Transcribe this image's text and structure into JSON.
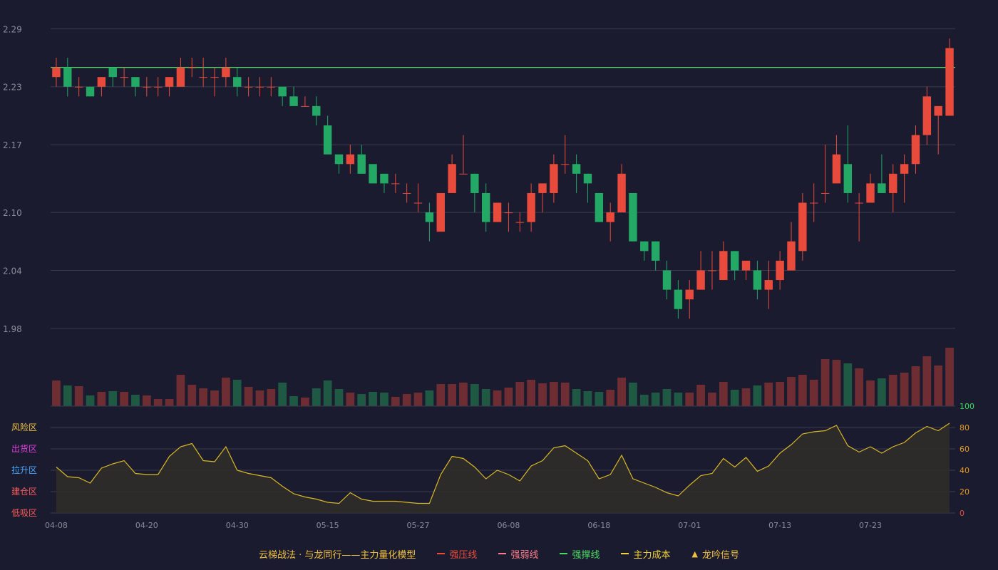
{
  "colors": {
    "background": "#1a1b2e",
    "grid": "#3a3c4e",
    "axis_text": "#8a8c9a",
    "up": "#e84b3c",
    "down": "#23a866",
    "vol_up": "#6e2d33",
    "vol_down": "#1f5944",
    "support_line": "#4bd964",
    "osc_line": "#d9b826",
    "osc_fill": "#302c2a",
    "osc_axis": "#e69a21",
    "osc_axis_top": "#33e05a",
    "osc_axis_zero": "#e84b3c"
  },
  "chart_data": [
    {
      "type": "candlestick",
      "price_axis": {
        "ylim": [
          1.96,
          2.305
        ],
        "ticks": [
          "2.29",
          "2.23",
          "2.17",
          "2.10",
          "2.04",
          "1.98"
        ],
        "tick_values": [
          2.29,
          2.23,
          2.17,
          2.1,
          2.04,
          1.98
        ]
      },
      "x_ticks": [
        {
          "index": 0,
          "label": "04-08"
        },
        {
          "index": 8,
          "label": "04-20"
        },
        {
          "index": 16,
          "label": "04-30"
        },
        {
          "index": 24,
          "label": "05-15"
        },
        {
          "index": 32,
          "label": "05-27"
        },
        {
          "index": 40,
          "label": "06-08"
        },
        {
          "index": 48,
          "label": "06-18"
        },
        {
          "index": 56,
          "label": "07-01"
        },
        {
          "index": 64,
          "label": "07-13"
        },
        {
          "index": 72,
          "label": "07-23"
        }
      ],
      "support_line": 2.25,
      "candles": [
        [
          2.24,
          2.25,
          2.26,
          2.23
        ],
        [
          2.25,
          2.23,
          2.26,
          2.22
        ],
        [
          2.23,
          2.23,
          2.24,
          2.22
        ],
        [
          2.23,
          2.22,
          2.23,
          2.22
        ],
        [
          2.23,
          2.24,
          2.24,
          2.22
        ],
        [
          2.25,
          2.24,
          2.25,
          2.23
        ],
        [
          2.24,
          2.24,
          2.25,
          2.23
        ],
        [
          2.24,
          2.23,
          2.24,
          2.22
        ],
        [
          2.23,
          2.23,
          2.24,
          2.22
        ],
        [
          2.23,
          2.23,
          2.24,
          2.22
        ],
        [
          2.23,
          2.24,
          2.24,
          2.22
        ],
        [
          2.23,
          2.25,
          2.26,
          2.23
        ],
        [
          2.25,
          2.25,
          2.26,
          2.24
        ],
        [
          2.24,
          2.24,
          2.26,
          2.23
        ],
        [
          2.24,
          2.24,
          2.25,
          2.22
        ],
        [
          2.24,
          2.25,
          2.26,
          2.23
        ],
        [
          2.24,
          2.23,
          2.25,
          2.22
        ],
        [
          2.23,
          2.23,
          2.24,
          2.22
        ],
        [
          2.23,
          2.23,
          2.24,
          2.22
        ],
        [
          2.23,
          2.23,
          2.24,
          2.22
        ],
        [
          2.23,
          2.22,
          2.23,
          2.21
        ],
        [
          2.22,
          2.21,
          2.23,
          2.21
        ],
        [
          2.21,
          2.21,
          2.22,
          2.21
        ],
        [
          2.21,
          2.2,
          2.22,
          2.19
        ],
        [
          2.19,
          2.16,
          2.2,
          2.16
        ],
        [
          2.16,
          2.15,
          2.16,
          2.14
        ],
        [
          2.15,
          2.16,
          2.17,
          2.14
        ],
        [
          2.16,
          2.14,
          2.17,
          2.14
        ],
        [
          2.15,
          2.13,
          2.15,
          2.13
        ],
        [
          2.14,
          2.13,
          2.14,
          2.12
        ],
        [
          2.13,
          2.13,
          2.14,
          2.12
        ],
        [
          2.12,
          2.12,
          2.13,
          2.11
        ],
        [
          2.11,
          2.11,
          2.13,
          2.1
        ],
        [
          2.1,
          2.09,
          2.11,
          2.07
        ],
        [
          2.08,
          2.12,
          2.12,
          2.08
        ],
        [
          2.12,
          2.15,
          2.16,
          2.12
        ],
        [
          2.14,
          2.14,
          2.18,
          2.14
        ],
        [
          2.14,
          2.12,
          2.14,
          2.1
        ],
        [
          2.12,
          2.09,
          2.13,
          2.08
        ],
        [
          2.09,
          2.11,
          2.11,
          2.09
        ],
        [
          2.1,
          2.1,
          2.11,
          2.08
        ],
        [
          2.09,
          2.09,
          2.1,
          2.08
        ],
        [
          2.09,
          2.12,
          2.13,
          2.08
        ],
        [
          2.12,
          2.13,
          2.13,
          2.1
        ],
        [
          2.12,
          2.15,
          2.16,
          2.11
        ],
        [
          2.15,
          2.15,
          2.18,
          2.14
        ],
        [
          2.15,
          2.14,
          2.16,
          2.12
        ],
        [
          2.14,
          2.13,
          2.14,
          2.11
        ],
        [
          2.12,
          2.09,
          2.12,
          2.09
        ],
        [
          2.09,
          2.1,
          2.11,
          2.07
        ],
        [
          2.1,
          2.14,
          2.15,
          2.1
        ],
        [
          2.12,
          2.07,
          2.12,
          2.07
        ],
        [
          2.07,
          2.06,
          2.07,
          2.05
        ],
        [
          2.07,
          2.05,
          2.07,
          2.04
        ],
        [
          2.04,
          2.02,
          2.05,
          2.01
        ],
        [
          2.02,
          2.0,
          2.03,
          1.99
        ],
        [
          2.01,
          2.02,
          2.03,
          1.99
        ],
        [
          2.02,
          2.04,
          2.06,
          2.02
        ],
        [
          2.04,
          2.04,
          2.06,
          2.02
        ],
        [
          2.03,
          2.06,
          2.07,
          2.03
        ],
        [
          2.06,
          2.04,
          2.06,
          2.03
        ],
        [
          2.04,
          2.05,
          2.05,
          2.03
        ],
        [
          2.04,
          2.02,
          2.05,
          2.01
        ],
        [
          2.02,
          2.03,
          2.05,
          2.0
        ],
        [
          2.03,
          2.05,
          2.06,
          2.02
        ],
        [
          2.04,
          2.07,
          2.09,
          2.04
        ],
        [
          2.06,
          2.11,
          2.12,
          2.05
        ],
        [
          2.11,
          2.11,
          2.13,
          2.09
        ],
        [
          2.12,
          2.12,
          2.17,
          2.11
        ],
        [
          2.13,
          2.16,
          2.18,
          2.13
        ],
        [
          2.15,
          2.12,
          2.19,
          2.11
        ],
        [
          2.11,
          2.11,
          2.12,
          2.07
        ],
        [
          2.11,
          2.13,
          2.14,
          2.11
        ],
        [
          2.13,
          2.12,
          2.16,
          2.12
        ],
        [
          2.12,
          2.14,
          2.15,
          2.1
        ],
        [
          2.14,
          2.15,
          2.16,
          2.11
        ],
        [
          2.15,
          2.18,
          2.19,
          2.14
        ],
        [
          2.18,
          2.22,
          2.23,
          2.17
        ],
        [
          2.2,
          2.21,
          2.21,
          2.16
        ],
        [
          2.2,
          2.27,
          2.28,
          2.2
        ]
      ],
      "volume": [
        36,
        29,
        28,
        15,
        20,
        21,
        20,
        16,
        15,
        10,
        10,
        44,
        30,
        25,
        22,
        40,
        37,
        27,
        22,
        24,
        33,
        14,
        12,
        25,
        36,
        24,
        19,
        17,
        20,
        19,
        13,
        17,
        19,
        22,
        31,
        31,
        33,
        31,
        24,
        22,
        26,
        34,
        37,
        32,
        34,
        33,
        24,
        21,
        20,
        23,
        40,
        33,
        16,
        19,
        24,
        19,
        19,
        30,
        19,
        34,
        23,
        25,
        29,
        33,
        34,
        41,
        44,
        37,
        66,
        65,
        60,
        53,
        36,
        39,
        44,
        47,
        56,
        70,
        57,
        82
      ]
    },
    {
      "type": "line",
      "ylim": [
        0,
        100
      ],
      "right_ticks": [
        "100",
        "80",
        "60",
        "40",
        "20",
        "0"
      ],
      "right_tick_values": [
        100,
        80,
        60,
        40,
        20,
        0
      ],
      "zone_labels": [
        "风险区",
        "出货区",
        "拉升区",
        "建仓区",
        "低吸区"
      ],
      "zone_values": [
        80,
        60,
        40,
        20,
        0
      ],
      "values": [
        43,
        34,
        33,
        28,
        42,
        46,
        49,
        37,
        36,
        36,
        53,
        62,
        65,
        49,
        48,
        62,
        40,
        37,
        35,
        33,
        25,
        18,
        15,
        13,
        10,
        9,
        19,
        13,
        11,
        11,
        11,
        10,
        9,
        9,
        36,
        53,
        51,
        43,
        32,
        40,
        36,
        30,
        44,
        49,
        61,
        63,
        56,
        49,
        32,
        36,
        54,
        32,
        28,
        24,
        19,
        16,
        26,
        35,
        37,
        51,
        43,
        52,
        39,
        44,
        56,
        64,
        74,
        76,
        77,
        82,
        63,
        57,
        62,
        56,
        62,
        66,
        75,
        81,
        77,
        84
      ]
    }
  ],
  "legend": {
    "title": "云梯战法 · 与龙同行——主力量化模型",
    "items": [
      {
        "label": "强压线",
        "color": "#e84b3c",
        "style": "solid"
      },
      {
        "label": "强弱线",
        "color": "#ff7a8a",
        "style": "dashed"
      },
      {
        "label": "强撑线",
        "color": "#4bd964",
        "style": "solid"
      },
      {
        "label": "主力成本",
        "color": "#f0d23a",
        "style": "dashed"
      },
      {
        "label": "龙吟信号",
        "color": "#f0c040",
        "style": "triangle"
      }
    ],
    "title_color": "#f0c040"
  }
}
